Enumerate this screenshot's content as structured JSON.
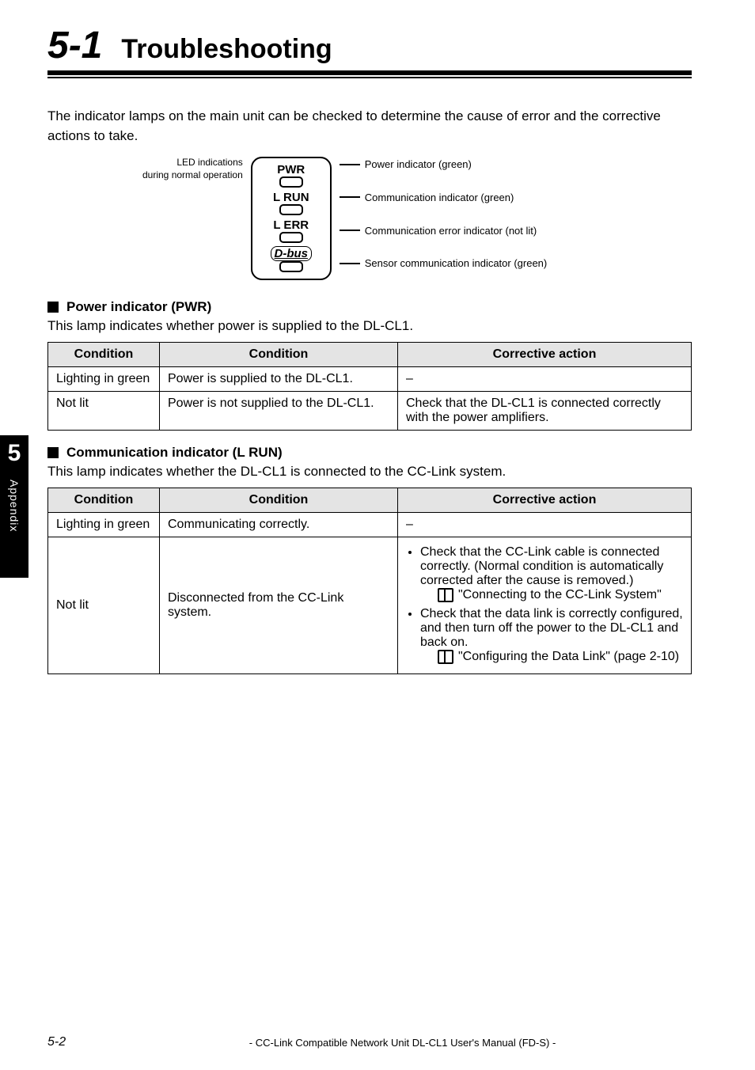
{
  "sidebar": {
    "chapter_number": "5",
    "label": "Appendix"
  },
  "chapter": {
    "number": "5-1",
    "title": "Troubleshooting"
  },
  "intro": "The indicator lamps on the main unit can be checked to determine the cause of error and the corrective actions to take.",
  "diagram": {
    "left_line_1": "LED indications",
    "left_line_2": "during normal operation",
    "labels": {
      "pwr": "PWR",
      "lrun": "L RUN",
      "lerr": "L ERR",
      "dbus": "D-bus"
    },
    "right": {
      "pwr": "Power indicator (green)",
      "lrun": "Communication indicator (green)",
      "lerr": "Communication error indicator (not lit)",
      "dbus": "Sensor communication indicator (green)"
    }
  },
  "table_headers": {
    "col1": "Condition",
    "col2": "Condition",
    "col3": "Corrective action"
  },
  "sections": {
    "pwr": {
      "heading": "Power indicator (PWR)",
      "sub": "This lamp indicates whether power is supplied to the DL-CL1.",
      "rows": [
        {
          "c1": "Lighting in green",
          "c2": "Power is supplied to the DL-CL1.",
          "c3": "–"
        },
        {
          "c1": "Not lit",
          "c2": "Power is not supplied to the DL-CL1.",
          "c3": "Check that the DL-CL1 is connected correctly with the power amplifiers."
        }
      ]
    },
    "lrun": {
      "heading": "Communication indicator (L RUN)",
      "sub": "This lamp indicates whether the DL-CL1 is connected to the CC-Link system.",
      "rows": [
        {
          "c1": "Lighting in green",
          "c2": "Communicating correctly.",
          "c3_dash": "–"
        },
        {
          "c1": "Not lit",
          "c2": "Disconnected from the CC-Link system.",
          "bullets": [
            "Check that the CC-Link cable is connected correctly. (Normal condition is automatically corrected after the cause is removed.)",
            "Check that the data link is correctly configured, and then turn off the power to the DL-CL1 and back on."
          ],
          "refs": [
            "\"Connecting to the CC-Link System\"",
            "\"Configuring the Data Link\" (page 2-10)"
          ]
        }
      ]
    }
  },
  "footer": {
    "page": "5-2",
    "text": "- CC-Link Compatible Network Unit DL-CL1 User's Manual (FD-S) -"
  }
}
